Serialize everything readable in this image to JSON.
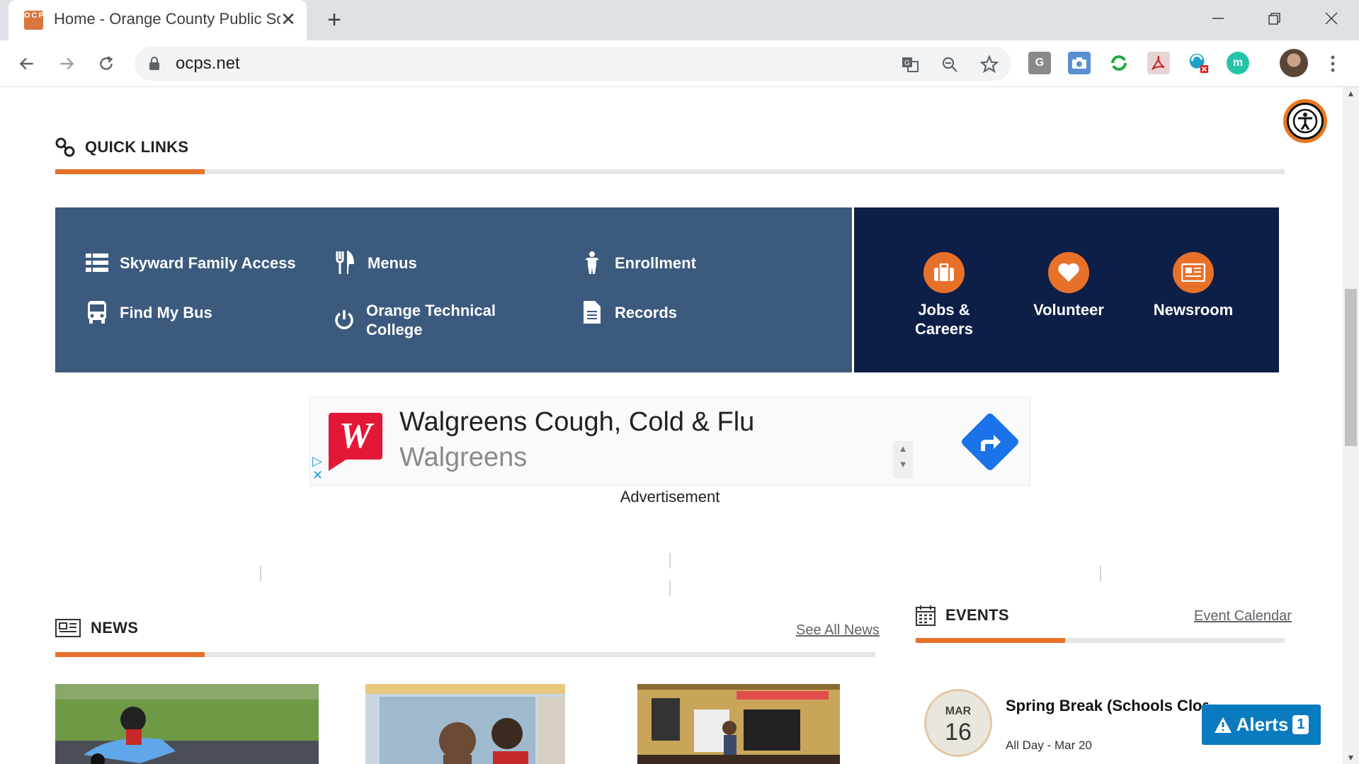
{
  "browser": {
    "tab_title": "Home - Orange County Public Sc",
    "favicon_text": "OCPS",
    "url": "ocps.net",
    "new_tab_glyph": "+",
    "close_glyph": "✕"
  },
  "quick_links": {
    "heading": "QUICK LINKS",
    "items": [
      {
        "label": "Skyward Family Access",
        "icon": "list-icon"
      },
      {
        "label": "Menus",
        "icon": "utensils-icon"
      },
      {
        "label": "Enrollment",
        "icon": "person-icon"
      },
      {
        "label": "Find My Bus",
        "icon": "bus-icon"
      },
      {
        "label": "Orange Technical College",
        "icon": "power-icon"
      },
      {
        "label": "Records",
        "icon": "document-icon"
      }
    ],
    "featured": [
      {
        "label": "Jobs & Careers",
        "icon": "briefcase-icon"
      },
      {
        "label": "Volunteer",
        "icon": "heart-icon"
      },
      {
        "label": "Newsroom",
        "icon": "newspaper-icon"
      }
    ]
  },
  "ad": {
    "title": "Walgreens Cough, Cold & Flu",
    "advertiser": "Walgreens",
    "logo_letter": "W",
    "label": "Advertisement"
  },
  "news": {
    "heading": "NEWS",
    "see_all": "See All News"
  },
  "events": {
    "heading": "EVENTS",
    "calendar_link": "Event Calendar",
    "items": [
      {
        "month": "MAR",
        "day": "16",
        "title": "Spring Break (Schools Closed/District Offices Open)",
        "time": "All Day - Mar 20"
      }
    ]
  },
  "alerts": {
    "label": "Alerts",
    "count": "1"
  },
  "colors": {
    "accent": "#e8712a",
    "panel": "#3b5a7e",
    "panel_dark": "#0d1f47",
    "alerts": "#0a7bbf"
  }
}
